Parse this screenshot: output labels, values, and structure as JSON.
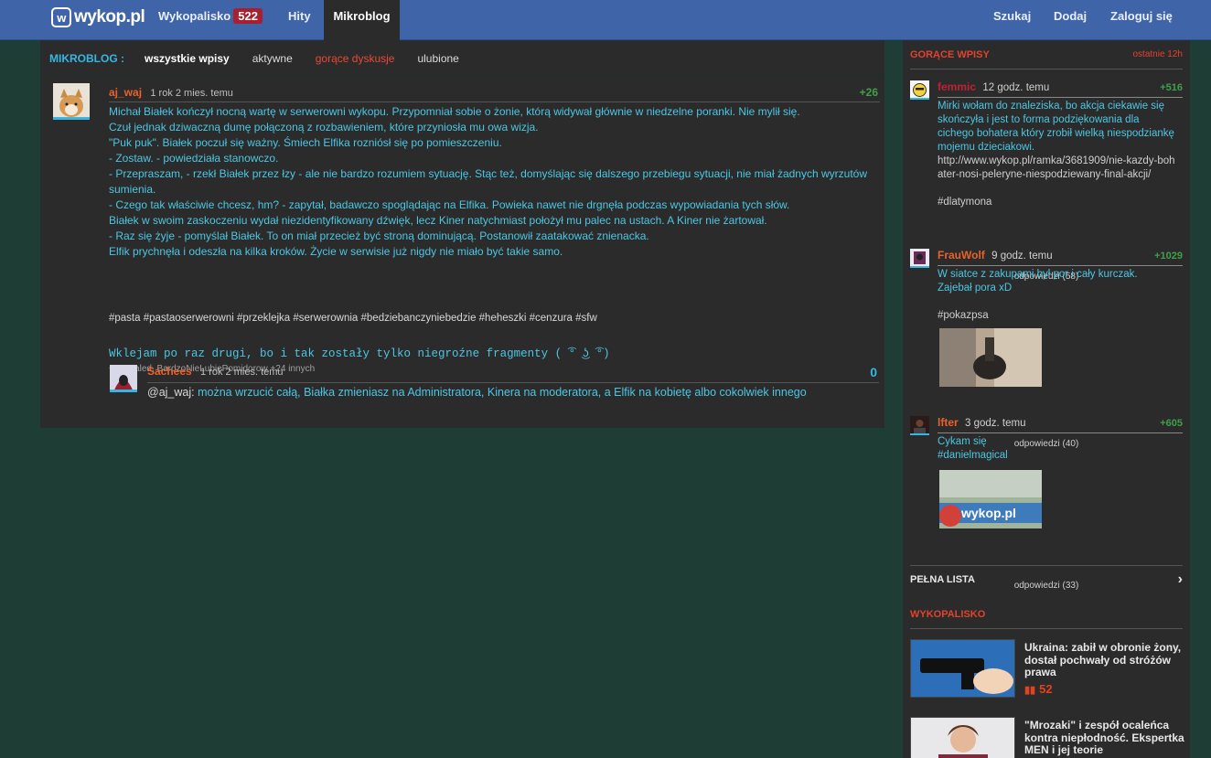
{
  "topbar": {
    "logo_text": "wykop.pl",
    "logo_icon": "wykop-logo-icon",
    "nav": [
      {
        "label": "Wykopalisko",
        "badge": "522"
      },
      {
        "label": "Hity"
      },
      {
        "label": "Mikroblog"
      }
    ],
    "right": [
      "Szukaj",
      "Dodaj",
      "Zaloguj się"
    ]
  },
  "tabs": {
    "title": "MIKROBLOG :",
    "items": [
      "wszystkie wpisy",
      "aktywne",
      "gorące dyskusje",
      "ulubione"
    ]
  },
  "entry": {
    "author": "aj_waj",
    "time": "1 rok 2 mies. temu",
    "votes": "+26",
    "lines": [
      "Michał Białek kończył nocną wartę w serwerowni wykopu. Przypomniał sobie o żonie, którą widywał głównie w niedzelne poranki. Nie mylił się.",
      "Czuł jednak dziwaczną dumę połączoną z rozbawieniem, które przyniosła mu owa wizja.",
      "\"Puk puk\". Białek poczuł się ważny. Śmiech Elfika rozniósł się po pomieszczeniu.",
      "- Zostaw. - powiedziała stanowczo.",
      "- Przepraszam, - rzekł Białek przez łzy - ale nie bardzo rozumiem sytuację. Stąc też, domyślając się dalszego przebiegu sytuacji, nie miał żadnych wyrzutów sumienia.",
      "- Czego tak właściwie chcesz, hm? - zapytał, badawczo spoglądając na Elfika. Powieka nawet nie drgnęła podczas wypowiadania tych słów.",
      "Białek w swoim zaskoczeniu wydał niezidentyfikowany dźwięk, lecz Kiner natychmiast położył mu palec na ustach. A Kiner nie żartował.",
      "- Raz się żyje - pomyślał Białek. To on miał przecież być stroną dominującą. Postanowił zaatakować znienacka.",
      "Elfik prychnęła i odeszła na kilka kroków. Życie w serwisie już nigdy nie miało być takie samo."
    ],
    "tags": "#pasta #pastaoserwerowni #przeklejka #serwerownia #bedziebanczyniebedzie #heheszki #cenzura #sfw",
    "mono": "Wklejam po raz drugi, bo i tak zostały tylko niegroźne fragmenty ( ͡° ͜ʖ ͡°)",
    "plus": "+: metaled, BardzoNieLubiePomidorow +24 innych"
  },
  "comment": {
    "author": "Sachees",
    "time": "1 rok 2 mies. temu",
    "votes": "0",
    "handle": "@aj_waj:",
    "text": " można wrzucić całą, Białka zmieniasz na Administratora, Kinera na moderatora, a Elfik na kobietę albo cokolwiek innego"
  },
  "sidebar": {
    "title": "GORĄCE WPISY",
    "range": "ostatnie 12h",
    "entries": [
      {
        "author": "femmic",
        "time": "12 godz. temu",
        "votes": "+516",
        "lines": [
          "Mirki wołam do znaleziska, bo akcja ciekawie się skończyła i jest to forma podziękowania dla cichego bohatera który zrobił wielką niespodziankę mojemu dzieciakowi."
        ],
        "link": "http://www.wykop.pl/ramka/3681909/nie-kazdy-bohater-nosi-peleryne-niespodziewany-final-akcji/",
        "tag": "#dlatymona",
        "replies": "odpowiedzi (58)"
      },
      {
        "author": "FrauWolf",
        "time": "9 godz. temu",
        "votes": "+1029",
        "lines": [
          "W siatce z zakupami był por i cały kurczak.",
          "Zajebał pora xD"
        ],
        "tag": "#pokazpsa",
        "replies": "odpowiedzi (40)"
      },
      {
        "author": "lfter",
        "time": "3 godz. temu",
        "votes": "+605",
        "lines": [
          "Cykam się",
          "#danielmagical"
        ],
        "image_text": "wykop.pl",
        "replies": "odpowiedzi (33)"
      }
    ],
    "full_list": "PEŁNA LISTA"
  },
  "wykopalisko": {
    "title": "WYKOPALISKO",
    "items": [
      {
        "title": "Ukraina: zabił w obronie żony, dostał pochwały od stróżów prawa",
        "digs": "52"
      },
      {
        "title": "\"Mrozaki\" i zespół ocaleńca kontra niepłodność. Ekspertka MEN i jej teorie"
      }
    ]
  },
  "colors": {
    "accent": "#36b7e3",
    "author": "#e8622b",
    "hot": "#e84a33",
    "positive": "#3fa04a",
    "topbar": "#3f64a8"
  }
}
